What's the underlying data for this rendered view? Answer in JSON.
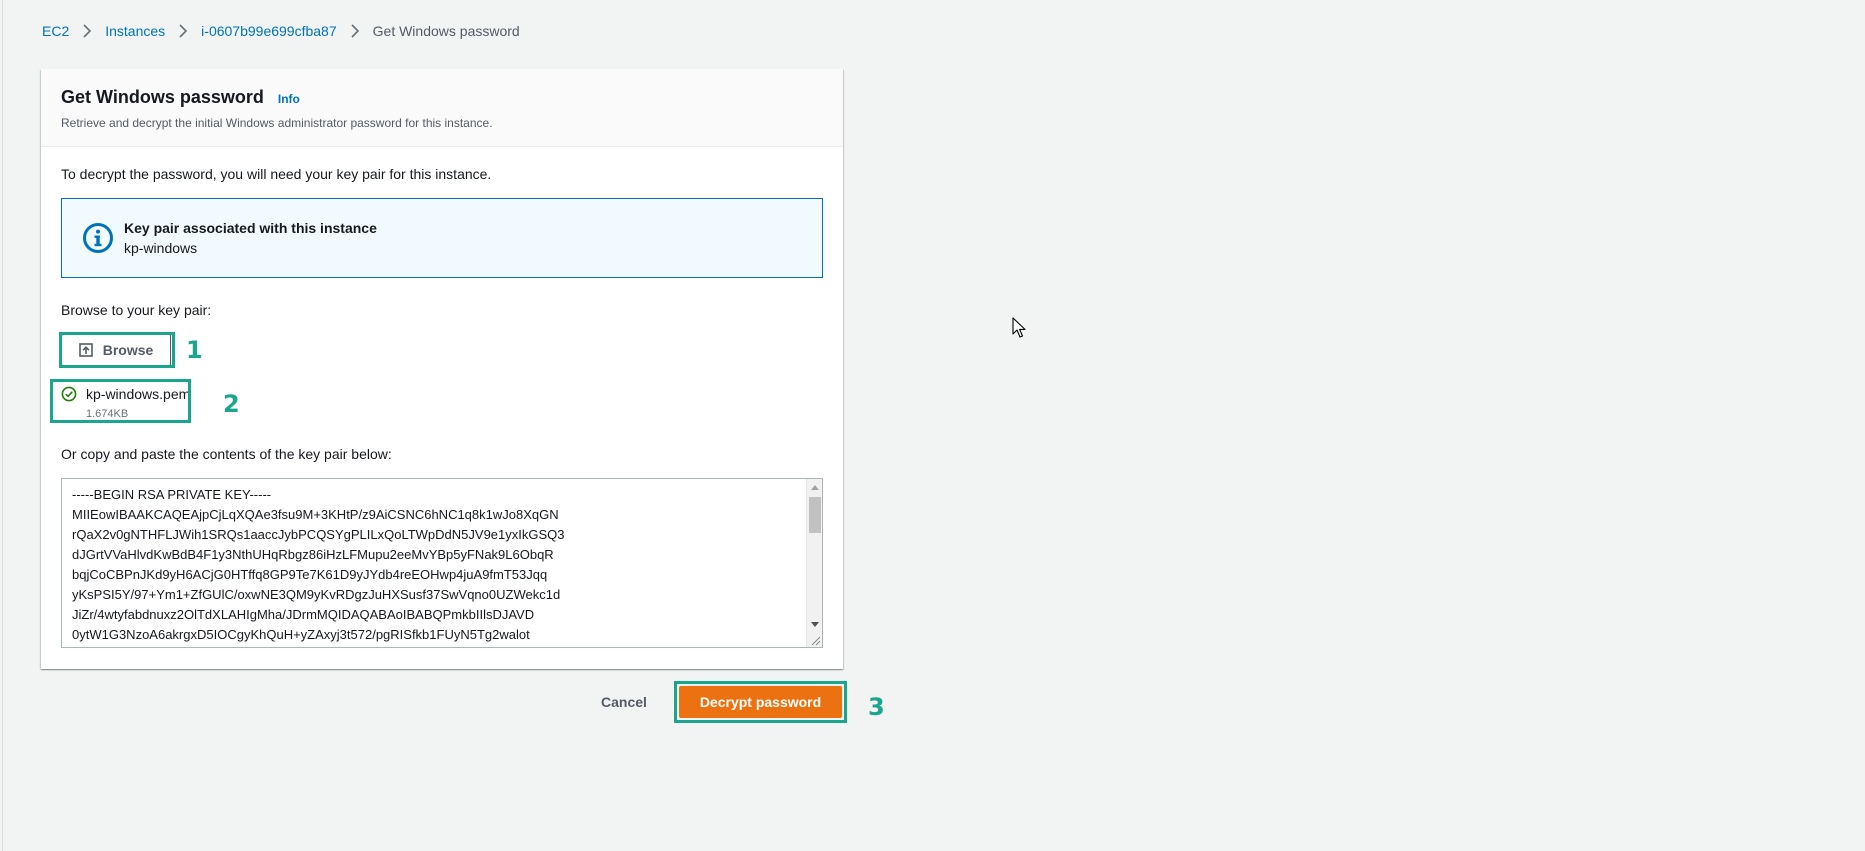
{
  "breadcrumb": {
    "items": [
      "EC2",
      "Instances",
      "i-0607b99e699cfba87"
    ],
    "current": "Get Windows password"
  },
  "panel": {
    "title": "Get Windows password",
    "info_link": "Info",
    "description": "Retrieve and decrypt the initial Windows administrator password for this instance."
  },
  "body": {
    "intro": "To decrypt the password, you will need your key pair for this instance.",
    "alert": {
      "title": "Key pair associated with this instance",
      "value": "kp-windows"
    },
    "browse_label": "Browse to your key pair:",
    "browse_button": "Browse",
    "file": {
      "name": "kp-windows.pem",
      "size": "1.674KB"
    },
    "paste_label": "Or copy and paste the contents of the key pair below:",
    "key_contents": "-----BEGIN RSA PRIVATE KEY-----\nMIIEowIBAAKCAQEAjpCjLqXQAe3fsu9M+3KHtP/z9AiCSNC6hNC1q8k1wJo8XqGN\nrQaX2v0gNTHFLJWih1SRQs1aaccJybPCQSYgPLILxQoLTWpDdN5JV9e1yxIkGSQ3\ndJGrtVVaHlvdKwBdB4F1y3NthUHqRbgz86iHzLFMupu2eeMvYBp5yFNak9L6ObqR\nbqjCoCBPnJKd9yH6ACjG0HTffq8GP9Te7K61D9yJYdb4reEOHwp4juA9fmT53Jqq\nyKsPSI5Y/97+Ym1+ZfGUlC/oxwNE3QM9yKvRDgzJuHXSusf37SwVqno0UZWekc1d\nJiZr/4wtyfabdnuxz2OlTdXLAHIgMha/JDrmMQIDAQABAoIBABQPmkbIIlsDJAVD\n0ytW1G3NzoA6akrgxD5IOCgyKhQuH+yZAxyj3t572/pgRISfkb1FUyN5Tg2walot"
  },
  "actions": {
    "cancel": "Cancel",
    "decrypt": "Decrypt password"
  },
  "annotations": {
    "step1": "1",
    "step2": "2",
    "step3": "3"
  },
  "colors": {
    "link": "#0073bb",
    "primary_button": "#ec7211",
    "highlight": "#1aa58d",
    "success": "#1d8102"
  },
  "icons": {
    "alert": "info-circle-icon",
    "browse": "upload-icon",
    "file_status": "check-circle-icon"
  }
}
